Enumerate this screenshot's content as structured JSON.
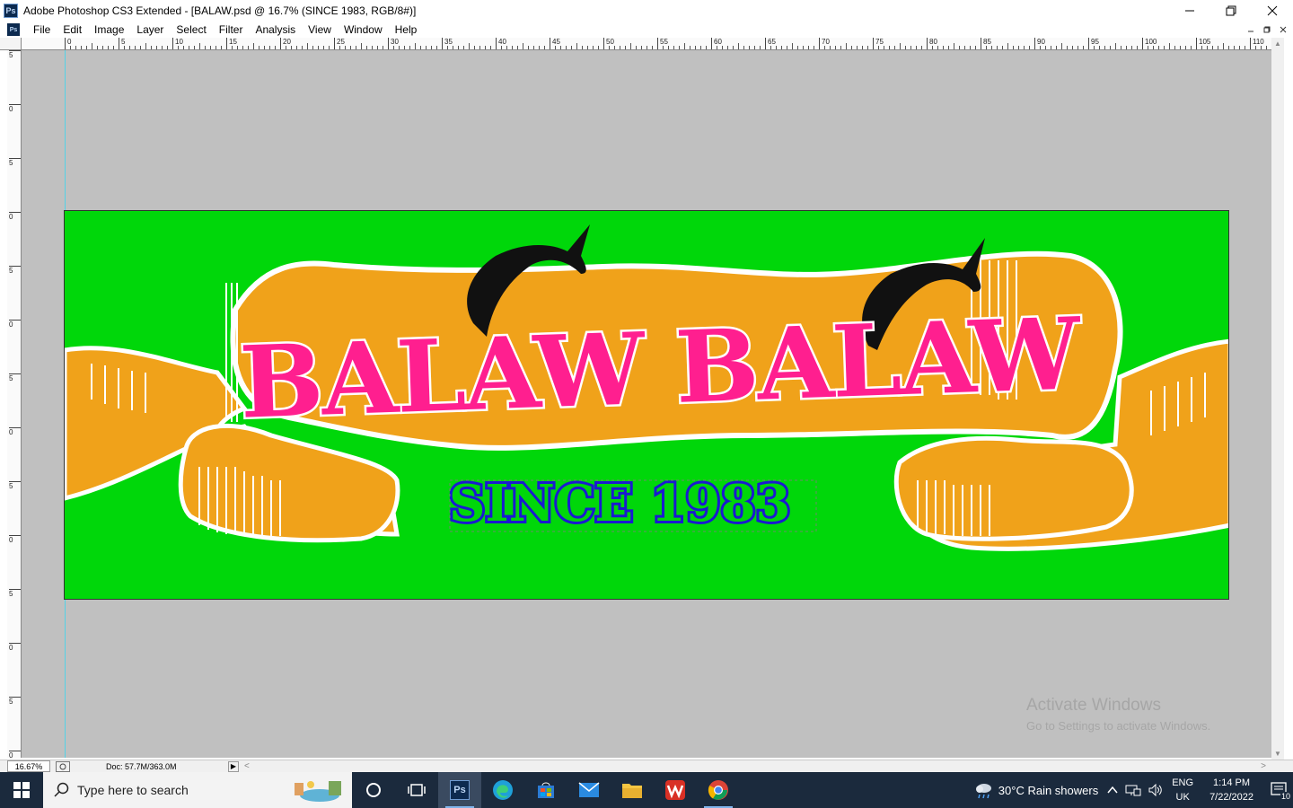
{
  "window": {
    "app_icon": "Ps",
    "title": "Adobe Photoshop CS3 Extended - [BALAW.psd @ 16.7% (SINCE 1983, RGB/8#)]",
    "controls": [
      "minimize-icon",
      "restore-icon",
      "close-icon"
    ]
  },
  "menubar": {
    "items": [
      "File",
      "Edit",
      "Image",
      "Layer",
      "Select",
      "Filter",
      "Analysis",
      "View",
      "Window",
      "Help"
    ]
  },
  "ruler": {
    "h_labels": [
      "0",
      "5",
      "10",
      "15",
      "20",
      "25",
      "30",
      "35",
      "40",
      "45",
      "50",
      "55",
      "60",
      "65",
      "70",
      "75",
      "80",
      "85",
      "90",
      "95",
      "100",
      "105",
      "110"
    ],
    "v_labels": [
      "5",
      "0",
      "5",
      "0",
      "5",
      "0",
      "5",
      "0",
      "5",
      "0",
      "5",
      "0",
      "5",
      "0"
    ]
  },
  "canvas": {
    "background": "#00d70a",
    "banner_color": "#f0a21a",
    "title_text": "BALAW BALAW",
    "title_color": "#ff1f8f",
    "subtitle_text": "SINCE 1983",
    "subtitle_fill": "#00d70a",
    "subtitle_stroke": "#1a1ad1",
    "fish_color": "#111111"
  },
  "watermark": {
    "line1": "Activate Windows",
    "line2": "Go to Settings to activate Windows."
  },
  "statusbar": {
    "zoom": "16.67%",
    "doc": "Doc: 57.7M/363.0M"
  },
  "taskbar": {
    "search_placeholder": "Type here to search",
    "weather": "30°C  Rain showers",
    "lang_top": "ENG",
    "lang_bottom": "UK",
    "time": "1:14 PM",
    "date": "7/22/2022",
    "notif_count": "10"
  }
}
